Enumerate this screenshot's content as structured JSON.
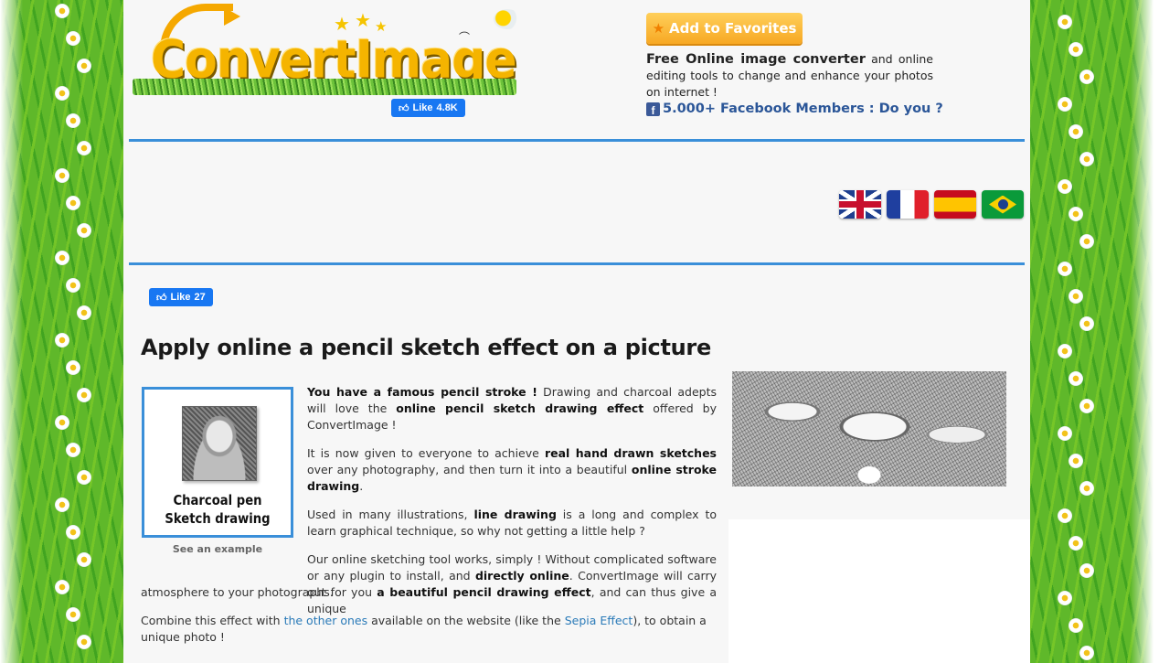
{
  "header": {
    "logo_text": "ConvertImage",
    "logo_like_label": "Like",
    "logo_like_count": "4.8K",
    "favorites_button": "Add to Favorites",
    "tagline_bold": "Free Online image converter",
    "tagline_rest": " and online editing tools to change and enhance your photos on internet !",
    "facebook_members": "5.000+ Facebook Members : Do you ?"
  },
  "languages": [
    {
      "icon": "flag-us-uk-icon"
    },
    {
      "icon": "flag-france-icon"
    },
    {
      "icon": "flag-spain-icon"
    },
    {
      "icon": "flag-brazil-icon"
    }
  ],
  "page_like": {
    "label": "Like",
    "count": "27"
  },
  "main": {
    "title": "Apply online a pencil sketch effect on a picture",
    "example_caption_line1": "Charcoal pen",
    "example_caption_line2": "Sketch drawing",
    "see_example": "See an example",
    "p1_bold": "You have a famous pencil stroke !",
    "p1_a": " Drawing and charcoal adepts will love the ",
    "p1_bold2": "online pencil sketch drawing effect",
    "p1_b": " offered by ConvertImage !",
    "p2_a": "It is now given to everyone to achieve ",
    "p2_bold": "real hand drawn sketches",
    "p2_b": " over any photography, and then turn it into a beautiful ",
    "p2_bold2": "online stroke drawing",
    "p2_c": ".",
    "p3_a": "Used in many illustrations, ",
    "p3_bold": "line drawing",
    "p3_b": " is a long and complex to learn graphical technique, so why not getting a little help ?",
    "p4_a": "Our online sketching tool works, simply ! Without complicated software or any plugin to install, and ",
    "p4_bold": "directly online",
    "p4_b": ". ConvertImage will carry out for you ",
    "p4_bold2": "a beautiful pencil drawing effect",
    "p4_c": ", and can thus give a unique",
    "p4_d": "atmosphere to your photographs.",
    "p5_a": "Combine this effect with ",
    "p5_link1": "the other ones",
    "p5_b": " available on the website (like the ",
    "p5_link2": "Sepia Effect",
    "p5_c": "), to obtain a",
    "p5_d": "unique photo !"
  },
  "colors": {
    "accent_blue": "#3a8fd9",
    "link_blue": "#2a7ab8",
    "facebook_blue": "#1877f2",
    "favorites_orange": "#f7a823"
  }
}
